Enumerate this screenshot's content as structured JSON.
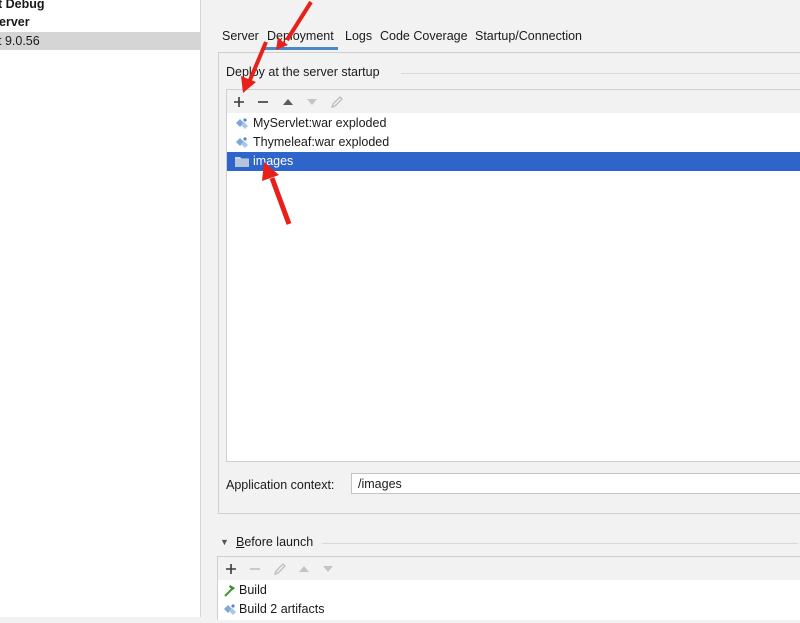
{
  "left_tree": {
    "items": [
      {
        "label": "t Debug",
        "bold": true
      },
      {
        "label": "erver",
        "bold": true
      },
      {
        "label": "t 9.0.56",
        "bold": false,
        "selected": true
      }
    ]
  },
  "tabs": [
    {
      "label": "Server"
    },
    {
      "label": "Deployment",
      "active": true
    },
    {
      "label": "Logs"
    },
    {
      "label": "Code Coverage"
    },
    {
      "label": "Startup/Connection"
    }
  ],
  "deploy": {
    "group_title": "Deploy at the server startup",
    "toolbar": {
      "add_icon": "plus-icon",
      "remove_icon": "minus-icon",
      "up_icon": "arrow-up-icon",
      "down_icon": "arrow-down-icon",
      "edit_icon": "pencil-icon"
    },
    "items": [
      {
        "label": "MyServlet:war exploded",
        "icon": "artifact-icon"
      },
      {
        "label": "Thymeleaf:war exploded",
        "icon": "artifact-icon"
      },
      {
        "label": "images",
        "icon": "folder-icon",
        "selected": true
      }
    ],
    "context_label": "Application context:",
    "context_value": "/images"
  },
  "before_launch": {
    "label_mnemonic": "B",
    "label_rest": "efore launch",
    "items": [
      {
        "label": "Build",
        "icon": "hammer-icon"
      },
      {
        "label": "Build 2 artifacts",
        "icon": "artifact-icon"
      }
    ]
  },
  "colors": {
    "selection": "#2f65ca",
    "tab_underline": "#4a88c7",
    "annotation_arrow": "#e8201a"
  }
}
